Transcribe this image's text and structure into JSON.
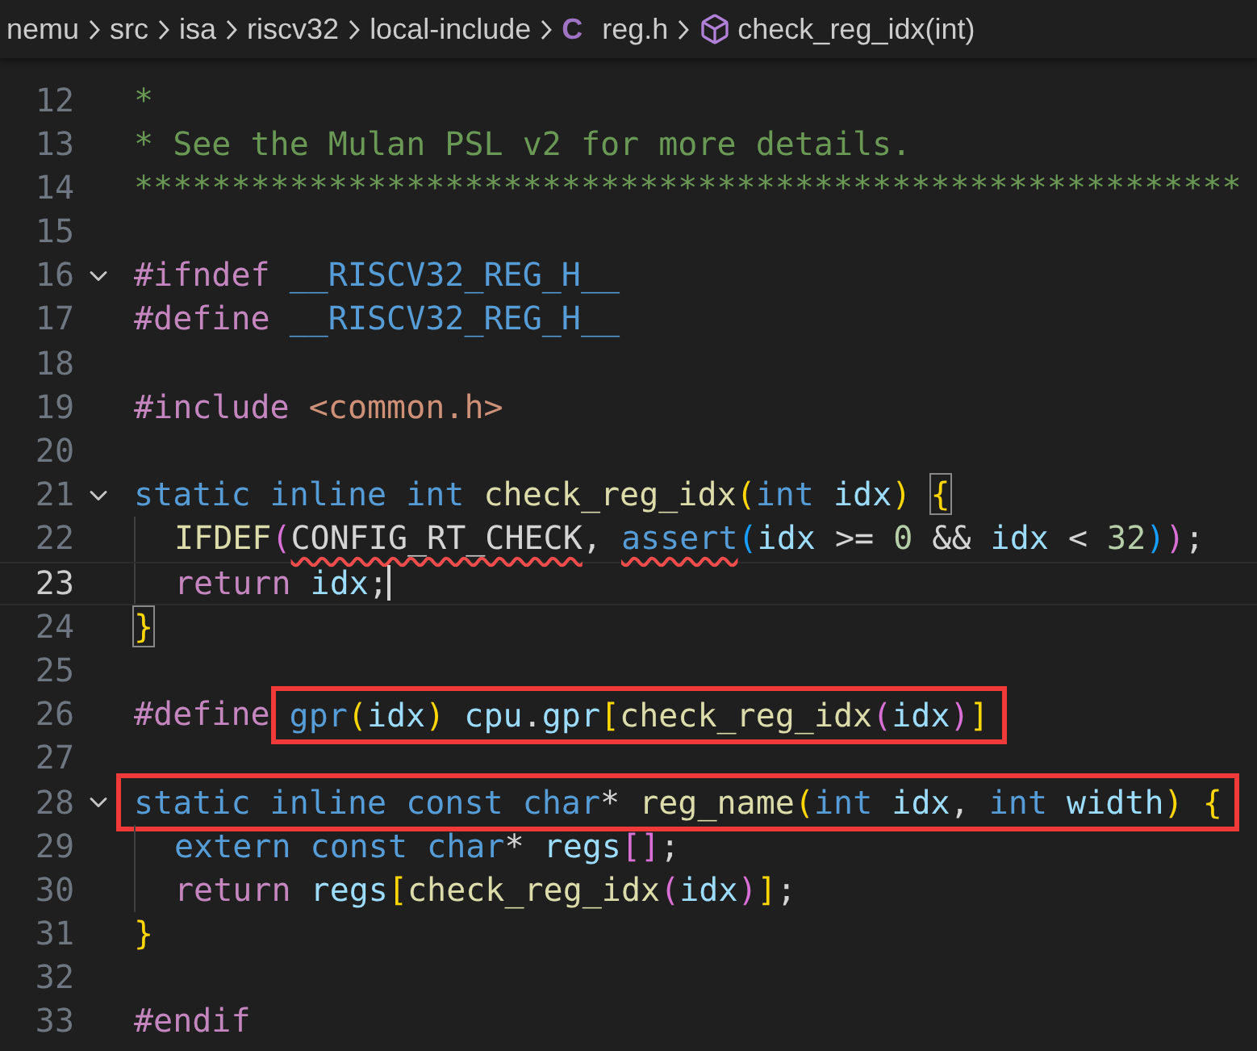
{
  "breadcrumb": [
    {
      "label": "nemu",
      "kind": "folder"
    },
    {
      "label": "src",
      "kind": "folder"
    },
    {
      "label": "isa",
      "kind": "folder"
    },
    {
      "label": "riscv32",
      "kind": "folder"
    },
    {
      "label": "local-include",
      "kind": "folder"
    },
    {
      "label": "reg.h",
      "kind": "file",
      "icon_text": "C"
    },
    {
      "label": "check_reg_idx(int)",
      "kind": "symbol"
    }
  ],
  "lines": [
    {
      "number": "12",
      "segments": [
        {
          "tokens": [
            {
              "text": "*",
              "kind": "comment"
            }
          ]
        }
      ]
    },
    {
      "number": "13",
      "segments": [
        {
          "tokens": [
            {
              "text": "* See the Mulan PSL v2 for more details.",
              "kind": "comment"
            }
          ]
        }
      ]
    },
    {
      "number": "14",
      "segments": [
        {
          "tokens": [
            {
              "text": "*********************************************************",
              "kind": "comment"
            }
          ]
        }
      ]
    },
    {
      "number": "15"
    },
    {
      "number": "16",
      "fold": true,
      "segments": [
        {
          "tokens": [
            {
              "text": "#ifndef",
              "kind": "control"
            },
            {
              "text": " __RISCV32_REG_H__",
              "kind": "macro"
            }
          ]
        }
      ]
    },
    {
      "number": "17",
      "segments": [
        {
          "tokens": [
            {
              "text": "#define",
              "kind": "control"
            },
            {
              "text": " __RISCV32_REG_H__",
              "kind": "macro"
            }
          ]
        }
      ]
    },
    {
      "number": "18"
    },
    {
      "number": "19",
      "segments": [
        {
          "tokens": [
            {
              "text": "#include",
              "kind": "control"
            },
            {
              "text": " <common.h>",
              "kind": "string"
            }
          ]
        }
      ]
    },
    {
      "number": "20"
    },
    {
      "number": "21",
      "fold": true,
      "segments": [
        {
          "tokens": [
            {
              "text": "static",
              "kind": "keyword"
            },
            {
              "text": " inline",
              "kind": "keyword"
            },
            {
              "text": " int",
              "kind": "keyword"
            },
            {
              "text": " check_reg_idx",
              "kind": "function"
            },
            {
              "text": "(",
              "kind": "bracket1"
            },
            {
              "text": "int",
              "kind": "keyword"
            },
            {
              "text": " idx",
              "kind": "variable"
            },
            {
              "text": ") ",
              "kind": "bracket1"
            },
            {
              "text": "{",
              "kind": "bracket1",
              "matched": true
            }
          ]
        }
      ]
    },
    {
      "number": "22",
      "indented": true,
      "segments": [
        {
          "tokens": [
            {
              "text": "IFDEF",
              "kind": "function"
            },
            {
              "text": "(",
              "kind": "bracket2"
            },
            {
              "text": "CONFIG_RT_CHECK",
              "kind": "plain",
              "squiggle": true
            },
            {
              "text": ", ",
              "kind": "plain"
            },
            {
              "text": "assert",
              "kind": "keyword",
              "squiggle": true
            },
            {
              "text": "(",
              "kind": "bracket3"
            },
            {
              "text": "idx",
              "kind": "variable"
            },
            {
              "text": " >= ",
              "kind": "plain"
            },
            {
              "text": "0",
              "kind": "number"
            },
            {
              "text": " && ",
              "kind": "plain"
            },
            {
              "text": "idx",
              "kind": "variable"
            },
            {
              "text": " < ",
              "kind": "plain"
            },
            {
              "text": "32",
              "kind": "number"
            },
            {
              "text": ")",
              "kind": "bracket3"
            },
            {
              "text": ")",
              "kind": "bracket2"
            },
            {
              "text": ";",
              "kind": "plain"
            }
          ]
        }
      ]
    },
    {
      "number": "23",
      "indented": true,
      "current": true,
      "segments": [
        {
          "tokens": [
            {
              "text": "return",
              "kind": "control"
            },
            {
              "text": " idx",
              "kind": "variable"
            },
            {
              "text": ";",
              "kind": "plain"
            }
          ]
        }
      ]
    },
    {
      "number": "24",
      "segments": [
        {
          "tokens": [
            {
              "text": "}",
              "kind": "bracket1",
              "matched": true
            }
          ]
        }
      ]
    },
    {
      "number": "25"
    },
    {
      "number": "26",
      "segments": [
        {
          "tokens": [
            {
              "text": "#define",
              "kind": "control"
            }
          ]
        },
        {
          "boxed": true,
          "tokens": [
            {
              "text": "gpr",
              "kind": "keyword"
            },
            {
              "text": "(",
              "kind": "bracket1"
            },
            {
              "text": "idx",
              "kind": "variable"
            },
            {
              "text": ")",
              "kind": "bracket1"
            },
            {
              "text": " cpu",
              "kind": "variable"
            },
            {
              "text": ".",
              "kind": "plain"
            },
            {
              "text": "gpr",
              "kind": "variable"
            },
            {
              "text": "[",
              "kind": "bracket1"
            },
            {
              "text": "check_reg_idx",
              "kind": "function"
            },
            {
              "text": "(",
              "kind": "bracket2"
            },
            {
              "text": "idx",
              "kind": "variable"
            },
            {
              "text": ")",
              "kind": "bracket2"
            },
            {
              "text": "]",
              "kind": "bracket1"
            }
          ]
        }
      ]
    },
    {
      "number": "27"
    },
    {
      "number": "28",
      "fold": true,
      "segments": [
        {
          "boxed": true,
          "tokens": [
            {
              "text": "static",
              "kind": "keyword"
            },
            {
              "text": " inline",
              "kind": "keyword"
            },
            {
              "text": " const",
              "kind": "keyword"
            },
            {
              "text": " char",
              "kind": "keyword"
            },
            {
              "text": "*",
              "kind": "plain"
            },
            {
              "text": " reg_name",
              "kind": "function"
            },
            {
              "text": "(",
              "kind": "bracket1"
            },
            {
              "text": "int",
              "kind": "keyword"
            },
            {
              "text": " idx",
              "kind": "variable"
            },
            {
              "text": ", ",
              "kind": "plain"
            },
            {
              "text": "int",
              "kind": "keyword"
            },
            {
              "text": " width",
              "kind": "variable"
            },
            {
              "text": ")",
              "kind": "bracket1"
            },
            {
              "text": " {",
              "kind": "bracket1"
            }
          ]
        }
      ]
    },
    {
      "number": "29",
      "indented": true,
      "segments": [
        {
          "tokens": [
            {
              "text": "extern",
              "kind": "keyword"
            },
            {
              "text": " const",
              "kind": "keyword"
            },
            {
              "text": " char",
              "kind": "keyword"
            },
            {
              "text": "*",
              "kind": "plain"
            },
            {
              "text": " regs",
              "kind": "variable"
            },
            {
              "text": "[]",
              "kind": "bracket2"
            },
            {
              "text": ";",
              "kind": "plain"
            }
          ]
        }
      ]
    },
    {
      "number": "30",
      "indented": true,
      "segments": [
        {
          "tokens": [
            {
              "text": "return",
              "kind": "control"
            },
            {
              "text": " regs",
              "kind": "variable"
            },
            {
              "text": "[",
              "kind": "bracket1"
            },
            {
              "text": "check_reg_idx",
              "kind": "function"
            },
            {
              "text": "(",
              "kind": "bracket2"
            },
            {
              "text": "idx",
              "kind": "variable"
            },
            {
              "text": ")",
              "kind": "bracket2"
            },
            {
              "text": "]",
              "kind": "bracket1"
            },
            {
              "text": ";",
              "kind": "plain"
            }
          ]
        }
      ]
    },
    {
      "number": "31",
      "segments": [
        {
          "tokens": [
            {
              "text": "}",
              "kind": "bracket1"
            }
          ]
        }
      ]
    },
    {
      "number": "32"
    },
    {
      "number": "33",
      "segments": [
        {
          "tokens": [
            {
              "text": "#endif",
              "kind": "control"
            }
          ]
        }
      ]
    }
  ]
}
